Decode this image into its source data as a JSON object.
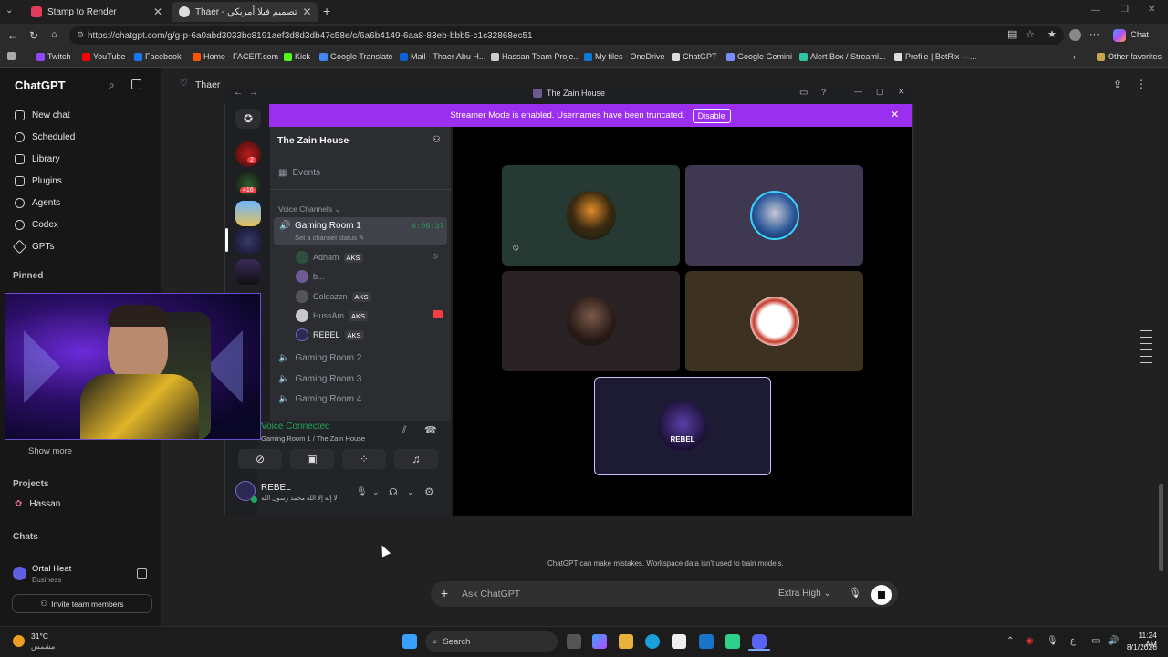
{
  "tabs": [
    {
      "title": "Stamp to Render",
      "active": false
    },
    {
      "title": "Thaer - تصميم فيلا أمريكي",
      "active": true
    }
  ],
  "address": {
    "url": "https://chatgpt.com/g/g-p-6a0abd3033bc8191aef3d8d3db47c58e/c/6a6b4149-6aa8-83eb-bbb5-c1c32868ec51",
    "profile_label": "Chat"
  },
  "favorites": [
    "Twitch",
    "YouTube",
    "Facebook",
    "Home - FACEIT.com",
    "Kick",
    "Google Translate",
    "Mail - Thaer Abu H...",
    "Hassan Team Proje...",
    "My files - OneDrive",
    "ChatGPT",
    "Google Gemini",
    "Alert Box / Streaml...",
    "Profile | BotRix —...",
    "Other favorites"
  ],
  "chatgpt": {
    "brand": "ChatGPT",
    "nav": [
      "New chat",
      "Scheduled",
      "Library",
      "Plugins",
      "Agents",
      "Codex",
      "GPTs"
    ],
    "pinned_label": "Pinned",
    "show_more": "Show more",
    "projects_label": "Projects",
    "project": "Hassan",
    "chats_label": "Chats",
    "user_name": "Ortal Heat",
    "user_plan": "Business",
    "invite": "Invite team members",
    "header_title": "Thaer",
    "disclaimer": "ChatGPT can make mistakes. Workspace data isn't used to train models.",
    "input_placeholder": "Ask ChatGPT",
    "model": "Extra High"
  },
  "discord": {
    "window_title": "The Zain House",
    "streamer_msg": "Streamer Mode is enabled. Usernames have been truncated.",
    "disable_label": "Disable",
    "server_name": "The Zain House",
    "events": "Events",
    "voice_category": "Voice Channels",
    "active_channel": "Gaming Room 1",
    "timer": "6:05:37",
    "channel_status": "Set a channel status",
    "members": [
      {
        "name": "Adham",
        "tag": "AKS"
      },
      {
        "name": "b...",
        "tag": ""
      },
      {
        "name": "Coldazzn",
        "tag": "AKS"
      },
      {
        "name": "HussAm",
        "tag": "AKS"
      },
      {
        "name": "REBEL",
        "tag": "AKS"
      }
    ],
    "other_channels": [
      "Gaming Room 2",
      "Gaming Room 3",
      "Gaming Room 4"
    ],
    "voice_connected": "Voice Connected",
    "voice_location": "Gaming Room 1 / The Zain House",
    "username": "REBEL",
    "user_status": "لا إله إلا الله محمد رسول الله",
    "badges": [
      "2",
      "416"
    ],
    "tiles": [
      {
        "label": "",
        "color": "#263a33"
      },
      {
        "label": "",
        "color": "#3f3851"
      },
      {
        "label": "",
        "color": "#2a2326"
      },
      {
        "label": "",
        "color": "#3d3122"
      },
      {
        "label": "REBEL",
        "color": "#1d1a33"
      }
    ]
  },
  "taskbar": {
    "temp": "31°C",
    "weather": "مشمس",
    "search": "Search",
    "time": "11:24 AM",
    "date": "8/1/2026",
    "lang": "ع"
  }
}
